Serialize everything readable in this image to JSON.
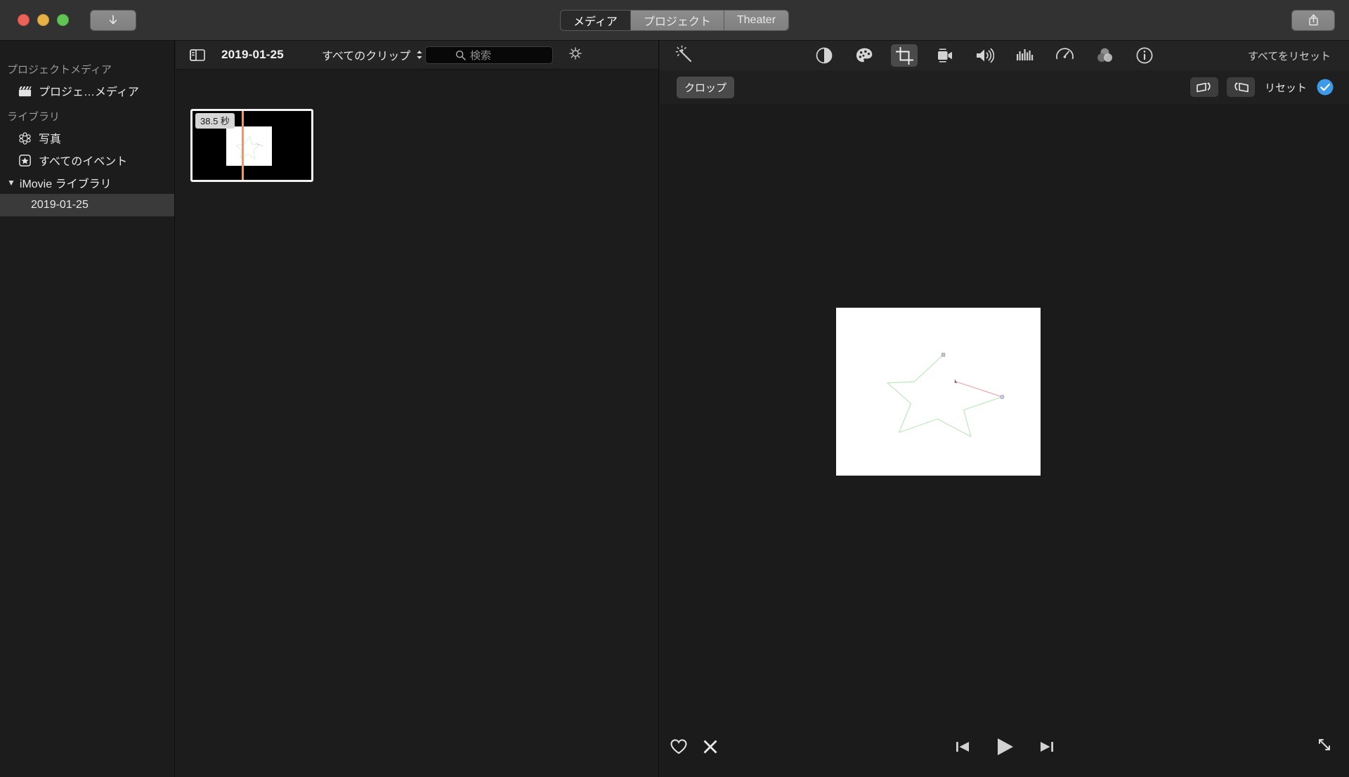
{
  "window": {
    "traffic_lights": [
      "close",
      "minimize",
      "zoom"
    ],
    "import_button_label": "",
    "share_button_label": ""
  },
  "tabs": [
    {
      "label": "メディア",
      "active": true,
      "name": "tab-media"
    },
    {
      "label": "プロジェクト",
      "active": false,
      "name": "tab-projects"
    },
    {
      "label": "Theater",
      "active": false,
      "name": "tab-theater"
    }
  ],
  "sidebar": {
    "sections": [
      {
        "heading": "プロジェクトメディア",
        "items": [
          {
            "label": "プロジェ…メディア",
            "icon": "clapperboard-icon",
            "selected": false
          }
        ]
      },
      {
        "heading": "ライブラリ",
        "items": [
          {
            "label": "写真",
            "icon": "photos-flower-icon",
            "selected": false
          },
          {
            "label": "すべてのイベント",
            "icon": "star-badge-icon",
            "selected": false
          }
        ]
      }
    ],
    "library_group": {
      "label": "iMovie ライブラリ",
      "expanded": true,
      "children": [
        {
          "label": "2019-01-25",
          "selected": true
        }
      ]
    }
  },
  "browser": {
    "sidebar_toggle": "sidebar-toggle-icon",
    "title": "2019-01-25",
    "filter_label": "すべてのクリップ",
    "search_placeholder": "検索",
    "search_value": "",
    "settings_icon": "gear-icon",
    "clips": [
      {
        "duration_badge": "38.5 秒",
        "selected": true
      }
    ]
  },
  "viewer": {
    "adjust_icons": [
      {
        "name": "magic-wand-icon",
        "active": false
      },
      {
        "name": "color-balance-icon",
        "active": false
      },
      {
        "name": "color-correction-icon",
        "active": false
      },
      {
        "name": "crop-icon",
        "active": true
      },
      {
        "name": "stabilization-icon",
        "active": false
      },
      {
        "name": "volume-icon",
        "active": false
      },
      {
        "name": "noise-reduction-icon",
        "active": false
      },
      {
        "name": "speed-icon",
        "active": false
      },
      {
        "name": "clip-filter-icon",
        "active": false
      },
      {
        "name": "info-icon",
        "active": false
      }
    ],
    "reset_all_label": "すべてをリセット",
    "crop_mode_label": "クロップ",
    "rotate_ccw_label": "",
    "rotate_cw_label": "",
    "reset_label": "リセット",
    "apply_label": "",
    "canvas": {
      "background": "#ffffff",
      "drawing": {
        "description": "star outline",
        "completed_stroke_color": "#b8e8b8",
        "active_stroke_color": "#f09a9a",
        "marker_color": "#9a9ab8"
      }
    },
    "transport": {
      "favorite_label": "",
      "reject_label": "",
      "previous_label": "",
      "play_label": "",
      "next_label": "",
      "fullscreen_label": ""
    }
  },
  "colors": {
    "window_chrome": "#323232",
    "panel_background": "#1c1c1c",
    "toolbar_background": "#242424",
    "selection": "#3a3a3a",
    "accent_blue": "#3d9ae8",
    "playhead_orange": "#e59b72"
  }
}
